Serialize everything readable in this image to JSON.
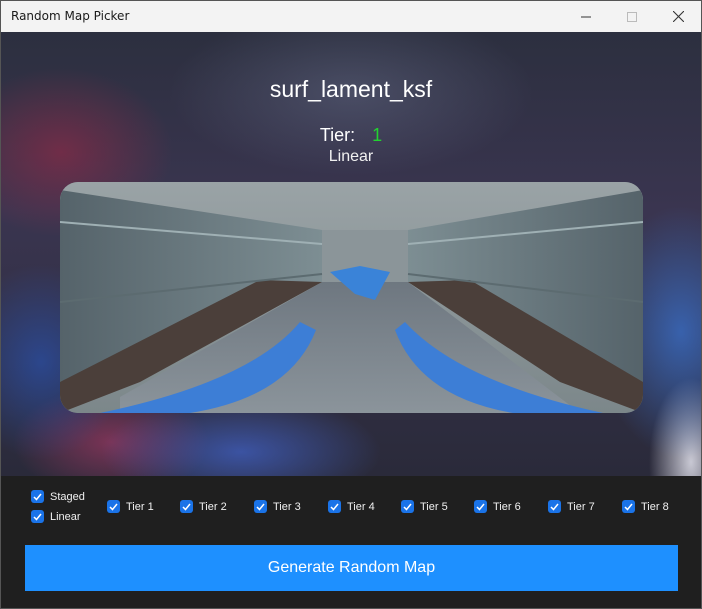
{
  "window": {
    "title": "Random Map Picker"
  },
  "map": {
    "name": "surf_lament_ksf",
    "tier_label": "Tier:",
    "tier_value": "1",
    "style": "Linear"
  },
  "filters": {
    "style_options": [
      {
        "label": "Staged",
        "checked": true
      },
      {
        "label": "Linear",
        "checked": true
      }
    ],
    "tiers": [
      {
        "label": "Tier 1",
        "checked": true
      },
      {
        "label": "Tier 2",
        "checked": true
      },
      {
        "label": "Tier 3",
        "checked": true
      },
      {
        "label": "Tier 4",
        "checked": true
      },
      {
        "label": "Tier 5",
        "checked": true
      },
      {
        "label": "Tier 6",
        "checked": true
      },
      {
        "label": "Tier 7",
        "checked": true
      },
      {
        "label": "Tier 8",
        "checked": true
      }
    ]
  },
  "actions": {
    "generate_label": "Generate Random Map"
  },
  "colors": {
    "accent": "#1e90ff",
    "checkbox": "#1a73e8",
    "tier_value": "#22d32f"
  }
}
